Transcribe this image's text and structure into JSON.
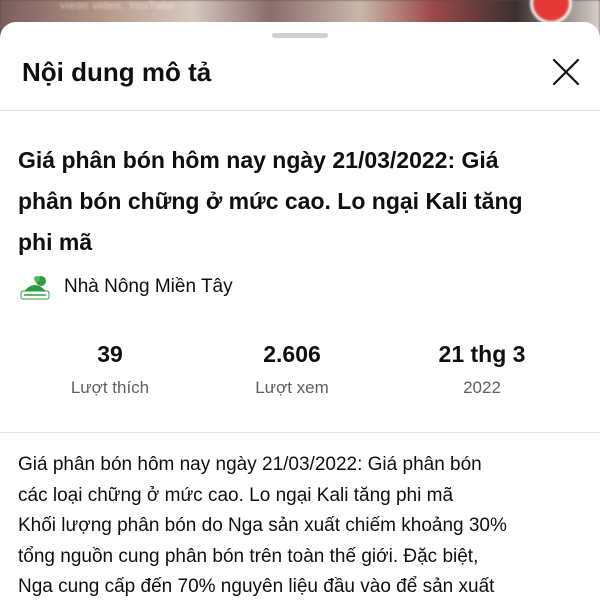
{
  "background_video": {
    "watermark_text": "vieon video, YouTube"
  },
  "sheet": {
    "title": "Nội dung mô tả",
    "close_icon": "close-icon"
  },
  "video": {
    "title_lines": [
      "Giá phân bón hôm nay ngày 21/03/2022: Giá",
      "phân bón chững ở mức cao. Lo ngại Kali tăng",
      "phi mã"
    ]
  },
  "channel": {
    "name": "Nhà Nông Miền Tây",
    "avatar_icon": "channel-logo-icon"
  },
  "stats": [
    {
      "value": "39",
      "label": "Lượt thích"
    },
    {
      "value": "2.606",
      "label": "Lượt xem"
    },
    {
      "value": "21 thg 3",
      "label": "2022"
    }
  ],
  "description": {
    "lines": [
      "Giá phân bón hôm nay ngày 21/03/2022: Giá phân bón",
      "các loại chững ở mức cao. Lo ngại Kali tăng phi mã",
      "Khối lượng phân bón do Nga sản xuất chiếm khoảng 30%",
      "tổng nguồn cung phân bón trên toàn thế giới. Đặc biệt,",
      "Nga cung cấp đến 70% nguyên liệu đầu vào để sản xuất"
    ]
  },
  "colors": {
    "text_primary": "#0f0f0f",
    "text_secondary": "#606060",
    "divider": "#e3e3e3",
    "sheet_background": "#ffffff",
    "channel_logo_green": "#2e9b3e"
  }
}
